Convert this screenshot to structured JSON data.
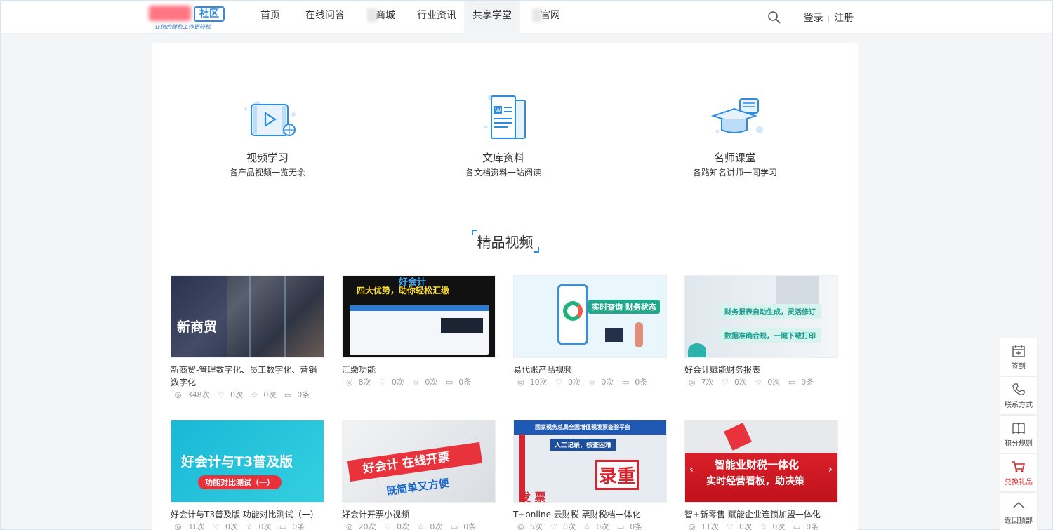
{
  "header": {
    "logo_badge": "社区",
    "logo_slogan": "让您的财税工作更轻松",
    "nav": [
      {
        "label": "首页"
      },
      {
        "label": "在线问答"
      },
      {
        "label": "商城"
      },
      {
        "label": "行业资讯"
      },
      {
        "label": "共享学堂",
        "active": true
      },
      {
        "label": "官网"
      }
    ],
    "login": "登录",
    "register": "注册"
  },
  "features": [
    {
      "title": "视频学习",
      "desc": "各产品视频一览无余",
      "icon": "video-icon"
    },
    {
      "title": "文库资料",
      "desc": "各文档资料一站阅读",
      "icon": "document-icon"
    },
    {
      "title": "名师课堂",
      "desc": "各路知名讲师一同学习",
      "icon": "graduation-cap-icon"
    }
  ],
  "section_title": "精品视频",
  "videos": [
    {
      "title": "新商贸-管理数字化、员工数字化、营销数字化",
      "views": "348次",
      "likes": "0次",
      "favs": "0次",
      "comments": "0条",
      "thumb_text": "新商贸"
    },
    {
      "title": "汇缴功能",
      "views": "8次",
      "likes": "0次",
      "favs": "0次",
      "comments": "0条",
      "thumb_text": "四大优势，助你轻松汇缴",
      "thumb_logo": "好会计"
    },
    {
      "title": "易代账产品视频",
      "views": "10次",
      "likes": "0次",
      "favs": "0次",
      "comments": "0条",
      "thumb_text": "实时查询 财务状态"
    },
    {
      "title": "好会计赋能财务报表",
      "views": "7次",
      "likes": "0次",
      "favs": "0次",
      "comments": "0条",
      "thumb_text": "财务报表自动生成，灵活修订",
      "thumb_text2": "数据准确合规，一键下载打印"
    },
    {
      "title": "好会计与T3普及版 功能对比测试（一）",
      "views": "31次",
      "likes": "0次",
      "favs": "0次",
      "comments": "0条",
      "thumb_text": "好会计与T3普及版",
      "thumb_text2": "功能对比测试（一）"
    },
    {
      "title": "好会计开票小视频",
      "views": "20次",
      "likes": "0次",
      "favs": "0次",
      "comments": "0条",
      "thumb_text": "好会计 在线开票",
      "thumb_text2": "既简单又方便"
    },
    {
      "title": "T+online 云财税 票财税档一体化",
      "views": "5次",
      "likes": "0次",
      "favs": "0次",
      "comments": "0条",
      "thumb_text": "国家税务总局全国增值税发票查验平台",
      "thumb_text2": "录重",
      "thumb_text3": "人工记录、核查困难",
      "thumb_text4": "发 票"
    },
    {
      "title": "智+新零售 赋能企业连锁加盟一体化",
      "views": "11次",
      "likes": "0次",
      "favs": "0次",
      "comments": "0条",
      "thumb_text": "智能业财税一体化",
      "thumb_text2": "实时经营看板，助决策"
    }
  ],
  "sidebar": [
    {
      "label": "签到",
      "icon": "calendar-icon"
    },
    {
      "label": "联系方式",
      "icon": "phone-icon"
    },
    {
      "label": "积分规则",
      "icon": "book-icon"
    },
    {
      "label": "兑换礼品",
      "icon": "cart-icon",
      "color": "#e02020"
    },
    {
      "label": "返回顶部",
      "icon": "arrow-up-icon"
    }
  ],
  "colors": {
    "accent": "#2a8de0",
    "red": "#e02020"
  }
}
